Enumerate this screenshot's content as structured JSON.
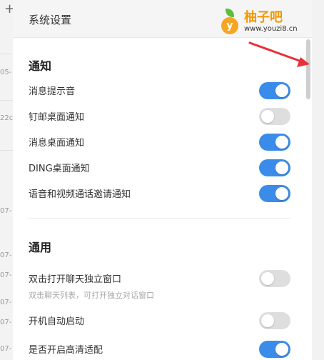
{
  "background_fragments": [
    "05-",
    "22c",
    "07-",
    "07-",
    "07-",
    "07-",
    "07-",
    "07-"
  ],
  "dialog": {
    "title": "系统设置",
    "sections": [
      {
        "heading": "通知",
        "items": [
          {
            "label": "消息提示音",
            "on": true
          },
          {
            "label": "钉邮桌面通知",
            "on": false
          },
          {
            "label": "消息桌面通知",
            "on": true
          },
          {
            "label": "DING桌面通知",
            "on": true
          },
          {
            "label": "语音和视频通话邀请通知",
            "on": true
          }
        ]
      },
      {
        "heading": "通用",
        "items": [
          {
            "label": "双击打开聊天独立窗口",
            "sub": "双击聊天列表，可打开独立对话窗口",
            "on": false
          },
          {
            "label": "开机自动启动",
            "on": false
          },
          {
            "label": "是否开启高清适配",
            "on": true
          }
        ]
      }
    ]
  },
  "watermark": {
    "logo_letter": "y",
    "name": "柚子吧",
    "url": "www.youzi8.cn"
  },
  "colors": {
    "toggle_on": "#3b8cea",
    "toggle_off": "#dedede",
    "arrow": "#e8303a",
    "brand": "#f39800"
  }
}
